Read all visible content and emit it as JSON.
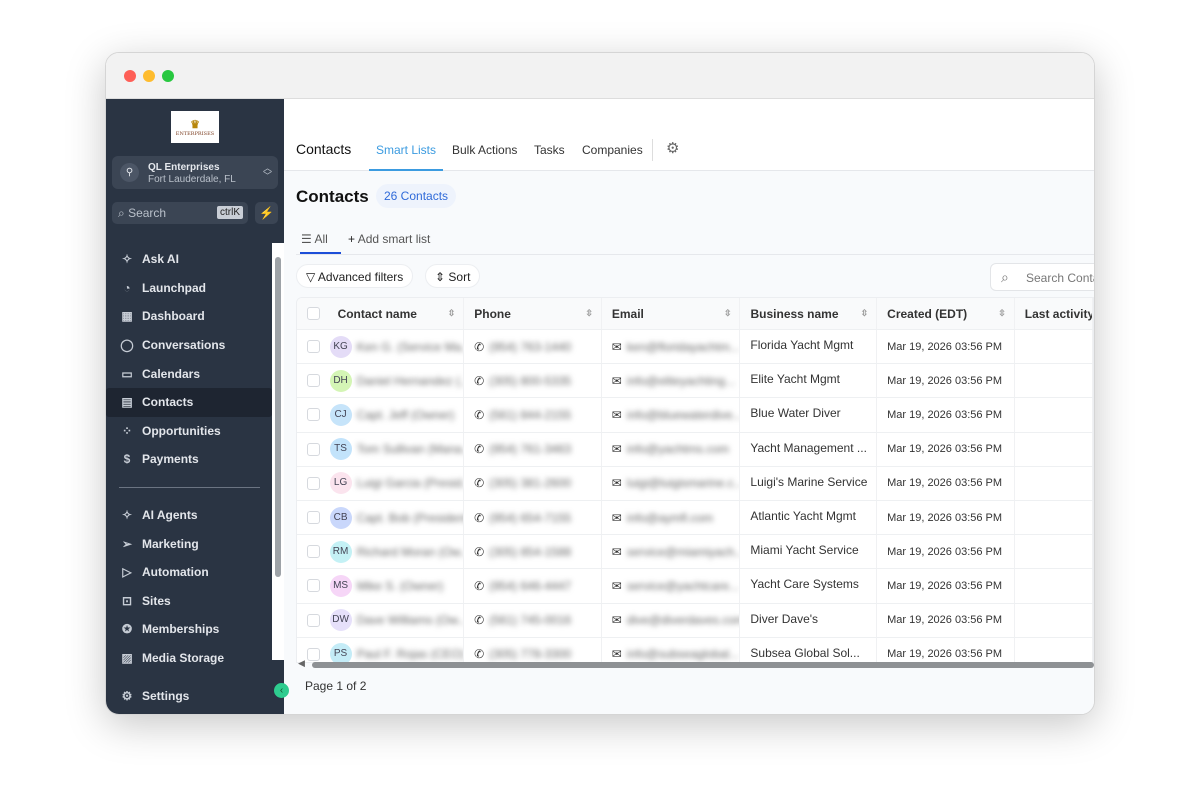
{
  "window": {
    "dots": [
      "#fe5f57",
      "#febc2e",
      "#28c840"
    ]
  },
  "sidebar": {
    "logo_text": "QL ENTERPRISES",
    "account": {
      "name": "QL Enterprises",
      "location": "Fort Lauderdale, FL"
    },
    "search": {
      "placeholder": "Search",
      "shortcut": "ctrlK"
    },
    "items": [
      {
        "label": "Ask AI",
        "icon": "sparkle-icon",
        "glyph": "✧"
      },
      {
        "label": "Launchpad",
        "icon": "rocket-icon",
        "glyph": "◔"
      },
      {
        "label": "Dashboard",
        "icon": "dashboard-icon",
        "glyph": "▦"
      },
      {
        "label": "Conversations",
        "icon": "chat-icon",
        "glyph": "◯"
      },
      {
        "label": "Calendars",
        "icon": "calendar-icon",
        "glyph": "▭"
      },
      {
        "label": "Contacts",
        "icon": "contacts-icon",
        "glyph": "▤",
        "active": true
      },
      {
        "label": "Opportunities",
        "icon": "opportunities-icon",
        "glyph": "⁘"
      },
      {
        "label": "Payments",
        "icon": "payments-icon",
        "glyph": "$"
      }
    ],
    "items2": [
      {
        "label": "AI Agents",
        "icon": "ai-agents-icon",
        "glyph": "✧"
      },
      {
        "label": "Marketing",
        "icon": "send-icon",
        "glyph": "➢"
      },
      {
        "label": "Automation",
        "icon": "automation-icon",
        "glyph": "▷"
      },
      {
        "label": "Sites",
        "icon": "sites-icon",
        "glyph": "⊡"
      },
      {
        "label": "Memberships",
        "icon": "award-icon",
        "glyph": "✪"
      },
      {
        "label": "Media Storage",
        "icon": "image-icon",
        "glyph": "▨"
      }
    ],
    "settings": "Settings"
  },
  "header": {
    "title": "Contacts",
    "tabs": [
      "Smart Lists",
      "Bulk Actions",
      "Tasks",
      "Companies"
    ]
  },
  "page": {
    "title": "Contacts",
    "count": "26 Contacts",
    "smart_lists": {
      "all": "All",
      "add": "Add smart list"
    },
    "filters": "Advanced filters",
    "sort": "Sort",
    "search_placeholder": "Search Contacts",
    "pagination": "Page 1 of 2"
  },
  "table": {
    "columns": [
      "Contact name",
      "Phone",
      "Email",
      "Business name",
      "Created (EDT)",
      "Last activity"
    ],
    "rows": [
      {
        "initials": "KG",
        "color": "#e4dcf7",
        "name": "Ken G. (Service Ma...",
        "phone": "(954) 763-1440",
        "email": "ken@floridayachtm...",
        "business": "Florida Yacht Mgmt",
        "created": "Mar 19, 2026 03:56 PM"
      },
      {
        "initials": "DH",
        "color": "#d4f5b5",
        "name": "Daniel Hernandez (...",
        "phone": "(305) 800-5335",
        "email": "info@eliteyachting...",
        "business": "Elite Yacht Mgmt",
        "created": "Mar 19, 2026 03:56 PM"
      },
      {
        "initials": "CJ",
        "color": "#c6e4fa",
        "name": "Capt. Jeff (Owner)",
        "phone": "(561) 844-2155",
        "email": "info@bluewaterdive...",
        "business": "Blue Water Diver",
        "created": "Mar 19, 2026 03:56 PM"
      },
      {
        "initials": "TS",
        "color": "#c2e3fb",
        "name": "Tom Sullivan (Mana...",
        "phone": "(954) 761-3463",
        "email": "info@yachtms.com",
        "business": "Yacht Management ...",
        "created": "Mar 19, 2026 03:56 PM"
      },
      {
        "initials": "LG",
        "color": "#fbe4ee",
        "name": "Luigi Garcia (Presid...",
        "phone": "(305) 381-2600",
        "email": "luigi@luigismarine.c...",
        "business": "Luigi's Marine Service",
        "created": "Mar 19, 2026 03:56 PM"
      },
      {
        "initials": "CB",
        "color": "#c9d7fb",
        "name": "Capt. Bob (President)",
        "phone": "(954) 654-7155",
        "email": "info@aymfl.com",
        "business": "Atlantic Yacht Mgmt",
        "created": "Mar 19, 2026 03:56 PM"
      },
      {
        "initials": "RM",
        "color": "#c4f1f5",
        "name": "Richard Moran (Ow...",
        "phone": "(305) 854-1588",
        "email": "service@miamiyach...",
        "business": "Miami Yacht Service",
        "created": "Mar 19, 2026 03:56 PM"
      },
      {
        "initials": "MS",
        "color": "#f6d6f7",
        "name": "Mike S. (Owner)",
        "phone": "(954) 646-4447",
        "email": "service@yachtcare...",
        "business": "Yacht Care Systems",
        "created": "Mar 19, 2026 03:56 PM"
      },
      {
        "initials": "DW",
        "color": "#e6e0fa",
        "name": "Dave Williams (Ow...",
        "phone": "(561) 745-0016",
        "email": "dive@diverdaves.com",
        "business": "Diver Dave's",
        "created": "Mar 19, 2026 03:56 PM"
      },
      {
        "initials": "PS",
        "color": "#c4ecf7",
        "name": "Paul F. Rojas (CEO)",
        "phone": "(305) 778-3300",
        "email": "info@subseaglobal...",
        "business": "Subsea Global Sol...",
        "created": "Mar 19, 2026 03:56 PM"
      }
    ]
  }
}
